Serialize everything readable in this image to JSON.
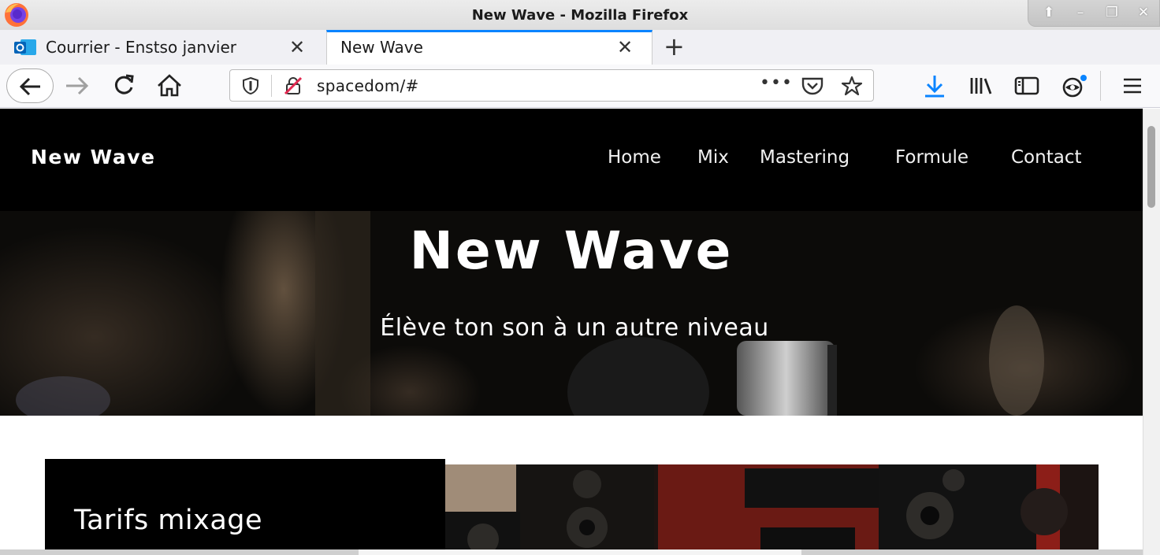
{
  "window": {
    "title": "New Wave - Mozilla Firefox",
    "controls": [
      "up-arrow-icon",
      "minimize-icon",
      "restore-icon",
      "close-icon"
    ]
  },
  "tabs": [
    {
      "label": "Courrier - Enstso janvier",
      "icon": "outlook-icon",
      "active": false
    },
    {
      "label": "New Wave",
      "active": true
    }
  ],
  "navbar": {
    "url": "spacedom/#",
    "icons": [
      "back-arrow-icon",
      "forward-arrow-icon",
      "reload-icon",
      "home-icon",
      "shield-icon",
      "insecure-lock-icon",
      "more-icon",
      "pocket-icon",
      "star-icon",
      "download-icon",
      "library-icon",
      "sidebar-icon",
      "account-icon",
      "menu-icon"
    ]
  },
  "site": {
    "logo": "New Wave",
    "nav": [
      "Home",
      "Mix",
      "Mastering",
      "Formule",
      "Contact"
    ],
    "hero": {
      "title": "New Wave",
      "subtitle": "Élève ton son à un autre niveau"
    },
    "card": {
      "title": "Tarifs mixage"
    }
  },
  "colors": {
    "accent": "#0a84ff",
    "header_bg": "#000000",
    "page_bg": "#ffffff"
  }
}
